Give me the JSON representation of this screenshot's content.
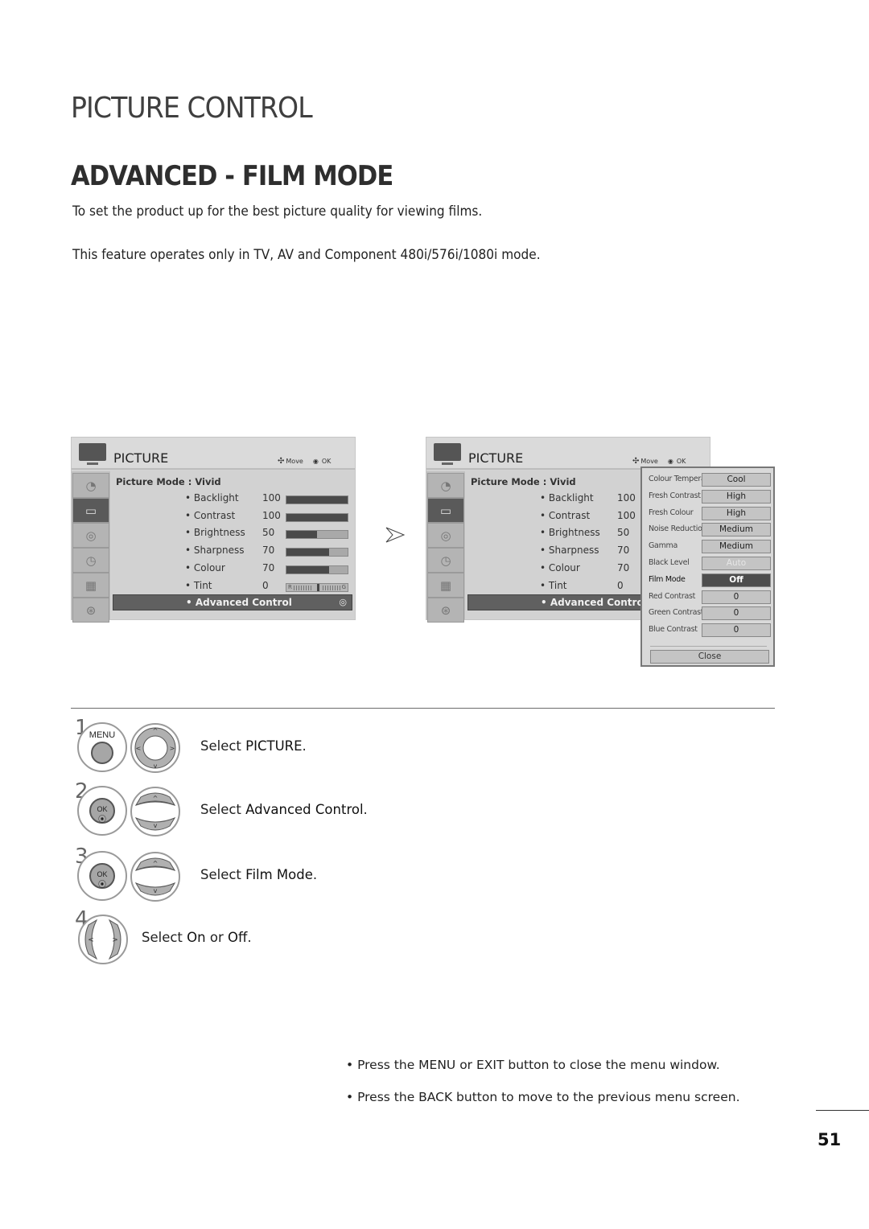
{
  "page": {
    "title": "PICTURE CONTROL",
    "section_title": "ADVANCED - FILM MODE",
    "intro": [
      "To set the product up for the best picture quality for viewing films.",
      "This feature operates only in TV, AV and Component 480i/576i/1080i mode."
    ],
    "page_number": "51"
  },
  "osd": {
    "title": "PICTURE",
    "nav_move": "Move",
    "nav_ok": "OK",
    "sidebar_icons": [
      "satellite-dish-icon",
      "tv-screen-icon",
      "speaker-icon",
      "clock-icon",
      "calendar-icon",
      "lock-icon"
    ],
    "active_sidebar_index": 1,
    "picture_mode_label": "Picture Mode",
    "picture_mode_value": ": Vivid",
    "settings": [
      {
        "label": "• Backlight",
        "value": "100",
        "level": 1.0
      },
      {
        "label": "• Contrast",
        "value": "100",
        "level": 1.0
      },
      {
        "label": "• Brightness",
        "value": "50",
        "level": 0.5
      },
      {
        "label": "• Sharpness",
        "value": "70",
        "level": 0.7
      },
      {
        "label": "• Colour",
        "value": "70",
        "level": 0.7
      },
      {
        "label": "• Tint",
        "value": "0",
        "tint_left": "R",
        "tint_right": "G"
      }
    ],
    "advanced_label": "• Advanced Control"
  },
  "advanced_popup": {
    "rows": [
      {
        "label": "Colour Temperature",
        "value": "Cool"
      },
      {
        "label": "Fresh Contrast",
        "value": "High"
      },
      {
        "label": "Fresh Colour",
        "value": "High"
      },
      {
        "label": "Noise Reduction",
        "value": "Medium"
      },
      {
        "label": "Gamma",
        "value": "Medium"
      },
      {
        "label": "Black Level",
        "value": "Auto",
        "disabled": true
      },
      {
        "label": "Film Mode",
        "value": "Off",
        "selected": true
      },
      {
        "label": "Red Contrast",
        "value": "0"
      },
      {
        "label": "Green Contrast",
        "value": "0"
      },
      {
        "label": "Blue Contrast",
        "value": "0"
      }
    ],
    "close_label": "Close"
  },
  "steps": [
    {
      "number": "1",
      "button": "MENU",
      "nav": "four-way",
      "text_prefix": "Select ",
      "text_bold": "PICTURE",
      "text_suffix": "."
    },
    {
      "number": "2",
      "button": "OK",
      "nav": "up-down",
      "text_prefix": "Select ",
      "text_bold": "Advanced Control",
      "text_suffix": "."
    },
    {
      "number": "3",
      "button": "OK",
      "nav": "up-down",
      "text_prefix": "Select ",
      "text_bold": "Film Mode",
      "text_suffix": "."
    },
    {
      "number": "4",
      "nav": "left-right",
      "text_prefix": "Select ",
      "text_bold": "On",
      "text_mid": " or ",
      "text_bold2": "Off",
      "text_suffix": "."
    }
  ],
  "notes": [
    {
      "prefix": "• Press the ",
      "b1": "MENU",
      "mid": " or ",
      "b2": "EXIT",
      "suffix": " button to close the menu window."
    },
    {
      "prefix": "• Press the ",
      "b1": "BACK",
      "suffix": " button to move to the previous menu screen."
    }
  ]
}
